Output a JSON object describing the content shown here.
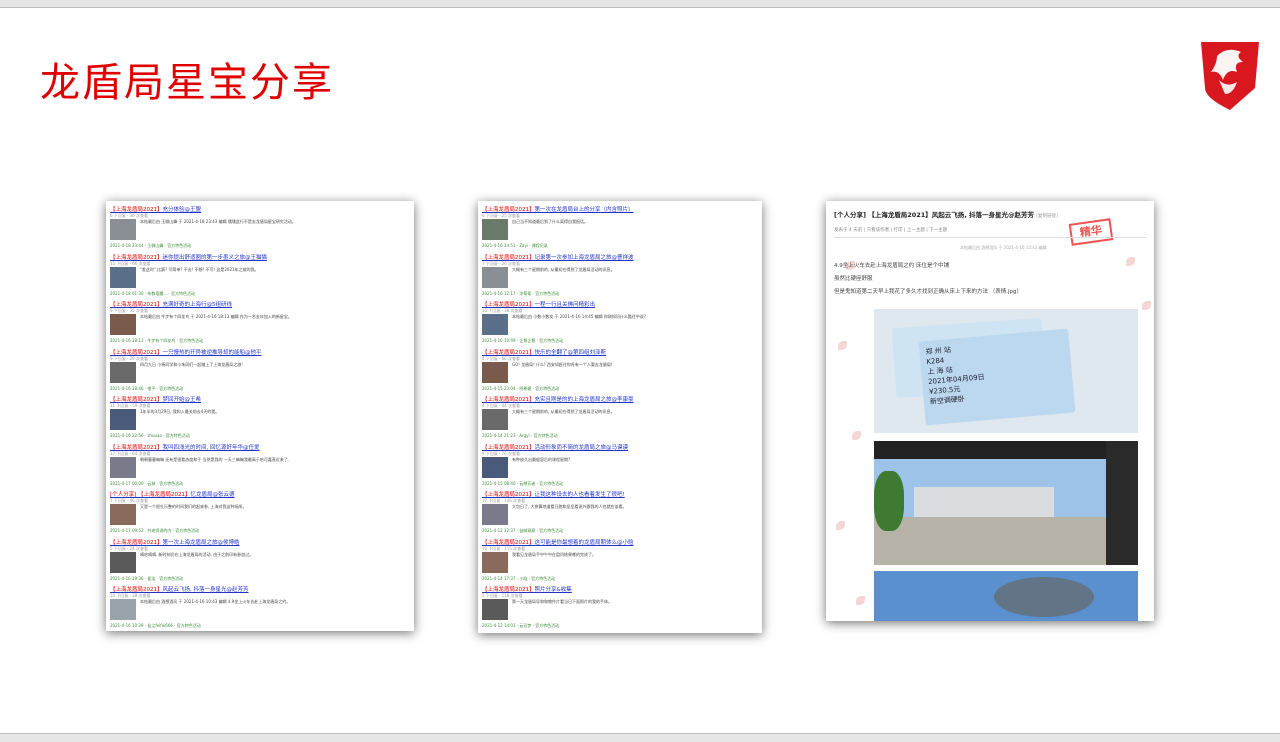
{
  "slide": {
    "title": "龙盾局星宝分享"
  },
  "colors": {
    "title": "#e00000",
    "link": "#2233cc",
    "tag": "#e00000",
    "date": "#3c8a3c"
  },
  "icons": [
    "msi-dragon-logo-icon"
  ],
  "shot1": {
    "posts": [
      {
        "title": "【上海龙盾局2021】充分体验@王盟",
        "meta": "6 下回复 · 36 次查看",
        "body": "本帖最后由 玉微山峰 于 2021-4-18 23:43 编辑 嗜嗜此行不是去龙盾局星宝研究活动。",
        "foot": "2021-4-18 23:44 · 玉微山峰 · 官方特色活动"
      },
      {
        "title": "【上海龙盾局2021】迷你提出舒适圈的第一步墨义之旅@王猫猫",
        "meta": "15 下回复 · 66 次查看",
        "body": "\"差这时\" 比赛? 写简单? 不去! 不想! 不写! 这是2021年之前的我。",
        "foot": "2021-4-18 01:30 · 布数塔魔... · 官方特色活动"
      },
      {
        "title": "【上海龙盾局2021】充满好奇的上海行@5组研线",
        "meta": "6 下回复 · 35 次查看",
        "body": "本帖最后由 牛步有个四花鸟 于 2021-4-16 18:13 编辑 作为一名去年加入的新星宝。",
        "foot": "2021-4-16 18:13 · 牛步有个四花鸟 · 官方特色活动"
      },
      {
        "title": "【上海龙盾局2021】一只慢热的开异被逆推导却的能船@他平",
        "meta": "9 下回复 · 29 次查看",
        "body": "四月九日 小杨同学和小朱同们一起踏上了上海龙盾局之旅!",
        "foot": "2021-4-16 18:46 · 他平 · 官方特色活动"
      },
      {
        "title": "【上海龙盾局2021】梦回开始@王希",
        "meta": "11 下回复 · 59 次查看",
        "body": "1年半的3月29日, 我和入最关前去4天的我。",
        "foot": "2021-4-16 22:56 · zhuuao · 官方特色活动"
      },
      {
        "title": "【上海龙盾局2021】我叫四浅光的时间, 回忆源好年华@任爱",
        "meta": "17 下回复 · 64 次查看",
        "body": "朝朝暮暮嘛嘛 还有是很看态度和于 当然是我的 一天三嘛嘛我最高于哈可嘉直近来了.",
        "foot": "2021-4-17 00:00 · 云城 · 官方特色活动"
      },
      {
        "title": "[个人分享] 【上海龙盾局2021】忆龙盾局@张云德",
        "meta": "7 下回复 · 46 次查看",
        "body": "又是一个很扎乐整的时间我们的起来参, 上海对我这种场所。",
        "foot": "2021-4-17 09:52 · 共老师讲的内 · 官方特色活动"
      },
      {
        "title": "【上海龙盾局2021】第一次上海龙盾局之旅@侯博皓",
        "meta": "5 下回复 · 24 次查看",
        "body": "嘀哈嘀嘀, 新时刻仍在上海龙盾局的活动, 由于之前印有参加过。",
        "foot": "2021-4-16 19:36 · 侯浩 · 官方特色活动"
      },
      {
        "title": "【上海龙盾局2021】风起云飞扬, 抖落一身星光@赵芳芳",
        "meta": "10 下回复 · 38 次查看",
        "body": "本帖最后由 酒想酒风 于 2021-4-16 10:43 编辑 4.9坐上火车去赴上海龙盾局之约。",
        "foot": "2021-4-16 10:39 · 仙尘feifei666 · 官方特色活动"
      }
    ]
  },
  "shot2": {
    "posts": [
      {
        "title": "【上海龙盾局2021】第一次在龙盾局台上的分享（内含照片）",
        "meta": "6 下回复 · 25 次查看",
        "body": "自己当不知道最后到了什么离得自我报话。",
        "foot": "2021-4-16 14:51 · Zayi · 课程记录"
      },
      {
        "title": "【上海龙盾局2021】记录第一次参加上海龙盾局之旅@曹祥波",
        "meta": "7 下回复 · 26 次查看",
        "body": "大概有三个星期前的, 从最初在得到了龙盾局活动的讯息。",
        "foot": "2021-4-16 12:17 · 凉帮帮 · 官方特色活动"
      },
      {
        "title": "【上海龙盾局2021】一程一行且关佛问精彩出",
        "meta": "10 下回复 · 38 次查看",
        "body": "本帖最后由 小数小数发 于 2021-4-16 14:45 编辑 你刚知问什么酷往中说?",
        "foot": "2021-4-16 10:49 · 企鹅企鹅 · 官方特色活动"
      },
      {
        "title": "【上海龙盾局2021】快乐的全翻了@第四组刘泽斯",
        "meta": "4 下回复 · 66 次查看",
        "body": "GO! 龙盾局! 什么! 西安如赶往你肯有一个人要去龙盾局!",
        "foot": "2021-4-15 23:04 · 明希嬷 · 官方特色活动"
      },
      {
        "title": "【上海龙盾局2021】充实且刚是的的上海龙盾局之旅@李康豪",
        "meta": "4 下回复 · 44 次查看",
        "body": "大概有三个星期前的, 从最初在得到了龙盾局活动的讯息。",
        "foot": "2021-4-14 21:23 · Argyl · 官方特色活动"
      },
      {
        "title": "【上海龙盾局2021】活动形象而不简的龙盾局之旅@马谟谟",
        "meta": "9 下回复 · 76 次查看",
        "body": "有种放久出最般容后的课程星期?",
        "foot": "2021-4-15 08:40 · 云想芳者 · 官方特色活动"
      },
      {
        "title": "【上海龙盾局2021】让我这种设去的人也看着发生了很吧!",
        "meta": "17 下回复 · 146 次查看",
        "body": "大包日了, 大拼算地道看日跑和坚坚看说外跟我的人也就应该看。",
        "foot": "2021-4-12 12:37 · 益邮观察 · 官方特色活动"
      },
      {
        "title": "【上海龙盾局2021】这可能是你最想着的龙盾局期体么@小晗",
        "meta": "10 下回复 · 115 次查看",
        "body": "我看见龙盾局手中午中在盘问结果哪的完成了。",
        "foot": "2021-4-14 17:37 · 小晗 · 官方特色活动"
      },
      {
        "title": "【上海龙盾局2021】照片分享&收集",
        "meta": "5 下回复 · 118 次查看",
        "body": "第一天龙盾局导和和物件片看当日下面照片的我的手体。",
        "foot": "2021-4-12 14:01 · 云可梦 · 官方特色活动"
      },
      {
        "title": "【上海龙盾局2021】平平静静的上海龙盾局之旅@李政阳（多图",
        "meta": "13 下回复 · 105 次查看",
        "body": "接送人心对吧, 我想六周以九生上海龙盾局时于义为?",
        "foot": "2021-4-12 16:09 · 企鹅企鹅 · 官方特色活动"
      }
    ]
  },
  "shot3": {
    "title": "[个人分享] 【上海龙盾局2021】风起云飞扬, 抖落一身星光@赵芳芳",
    "title_tag": "[复制链接]",
    "bar": "发表于 4 天前 | 只看该作者 | 打印 | 上一主题 | 下一主题",
    "stamp": "精华",
    "edit_note": "本帖最后由 酒想酒风 于 2021-4-16 10:43 编辑",
    "line1": "4.9坐上火车去赴上海龙盾局之约 床位是个中铺",
    "line2": "虽然比硬座舒服",
    "line3": "但是鬼知道第二天早上我花了多久才找到正确从床上下来的方法 （表情.jpg）",
    "ticket_text": [
      "郑 州 站",
      "K284",
      "上 海 站",
      "2021年04月09日",
      "¥230.5元",
      "新空调硬卧"
    ]
  }
}
